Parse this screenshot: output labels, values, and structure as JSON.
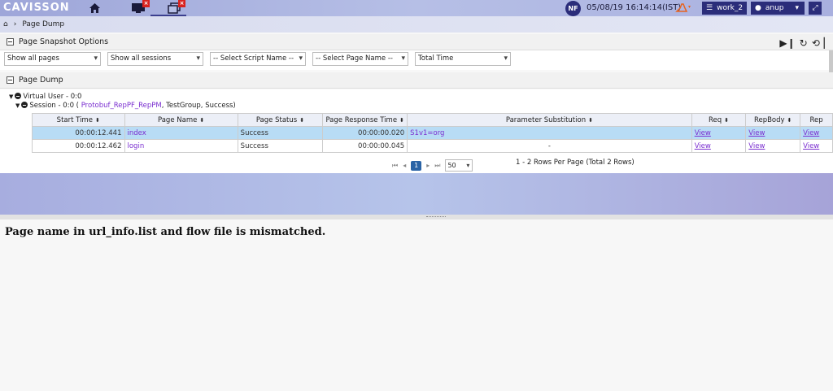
{
  "app": {
    "logo": "CAVISSON"
  },
  "topbar": {
    "user_initials": "NF",
    "datetime": "05/08/19 16:14:14(IST)",
    "workspace_label": "work_2",
    "user_label": "anup"
  },
  "breadcrumb": {
    "current": "Page Dump"
  },
  "snapshot_options": {
    "title": "Page Snapshot Options",
    "filters": {
      "pages": "Show all pages",
      "sessions": "Show all sessions",
      "script": "-- Select Script Name --",
      "page_name": "-- Select Page Name --",
      "time": "Total Time"
    }
  },
  "page_dump": {
    "title": "Page Dump",
    "tree": {
      "virtual_user": "Virtual User - 0:0",
      "session_prefix": "Session - 0:0 ( ",
      "session_script": "Protobuf_RepPF_RepPM",
      "session_suffix": ", TestGroup, Success)"
    },
    "columns": [
      "Start Time",
      "Page Name",
      "Page Status",
      "Page Response Time",
      "Parameter Substitution",
      "Req",
      "RepBody",
      "Rep"
    ],
    "rows": [
      {
        "start": "00:00:12.441",
        "page": "index",
        "status": "Success",
        "response": "00:00:00.020",
        "param": "S1v1=org",
        "req": "View",
        "repbody": "View",
        "rep": "View"
      },
      {
        "start": "00:00:12.462",
        "page": "login",
        "status": "Success",
        "response": "00:00:00.045",
        "param": "-",
        "req": "View",
        "repbody": "View",
        "rep": "View"
      }
    ],
    "pager": {
      "current_page": "1",
      "page_size": "50",
      "info": "1 - 2 Rows Per Page (Total 2 Rows)"
    }
  },
  "message": "Page name in url_info.list and flow file is mismatched."
}
